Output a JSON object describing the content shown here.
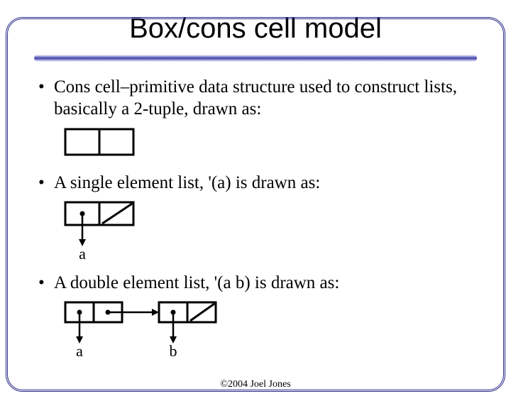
{
  "title": "Box/cons cell model",
  "bullets": {
    "b1": "Cons cell–primitive data structure used to construct lists, basically a 2-tuple, drawn as:",
    "b2": "A single element list, '(a) is drawn as:",
    "b3": "A double element list, '(a b) is drawn as:"
  },
  "labels": {
    "a": "a",
    "b": "b"
  },
  "footer": "©2004 Joel Jones"
}
